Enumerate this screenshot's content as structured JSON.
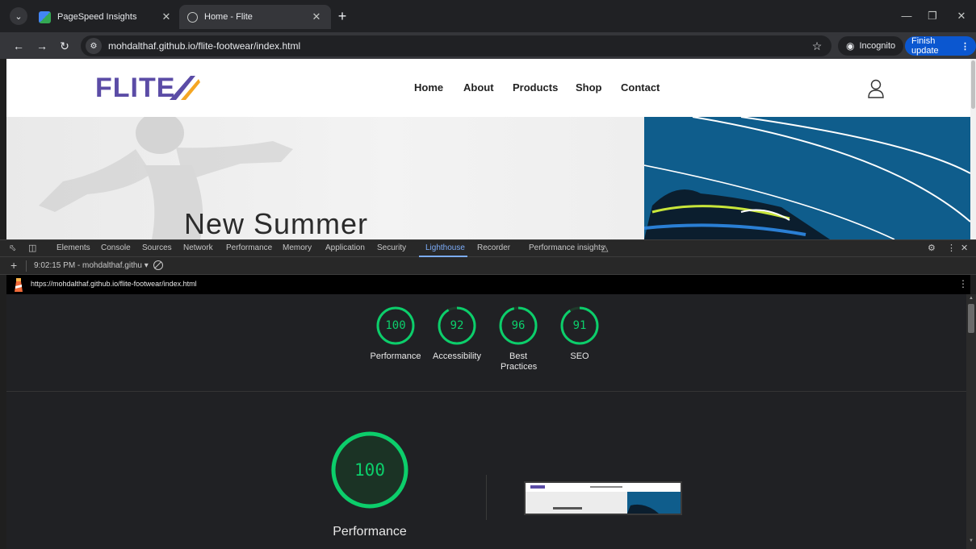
{
  "browser": {
    "tabs": [
      {
        "title": "PageSpeed Insights",
        "active": false
      },
      {
        "title": "Home - Flite",
        "active": true
      }
    ],
    "new_tab_glyph": "+",
    "url": "mohdalthaf.github.io/flite-footwear/index.html",
    "incognito_label": "Incognito",
    "finish_update_label": "Finish update",
    "accent_color": "#0b57d0"
  },
  "site": {
    "logo_text": "FLITE",
    "nav": [
      "Home",
      "About",
      "Products",
      "Shop",
      "Contact"
    ],
    "hero_heading": "New Summer",
    "brand_color": "#5b4ca6"
  },
  "devtools": {
    "tabs": [
      "Elements",
      "Console",
      "Sources",
      "Network",
      "Performance",
      "Memory",
      "Application",
      "Security",
      "Lighthouse",
      "Recorder",
      "Performance insights"
    ],
    "active_tab": "Lighthouse",
    "report_selector": "9:02:15 PM - mohdalthaf.githu",
    "report_url": "https://mohdalthaf.github.io/flite-footwear/index.html"
  },
  "lighthouse": {
    "pass_color": "#0cce6b",
    "scores": [
      {
        "label": "Performance",
        "value": 100
      },
      {
        "label": "Accessibility",
        "value": 92
      },
      {
        "label": "Best Practices",
        "value": 96
      },
      {
        "label": "SEO",
        "value": 91
      }
    ],
    "focus": {
      "label": "Performance",
      "value": 100
    }
  }
}
